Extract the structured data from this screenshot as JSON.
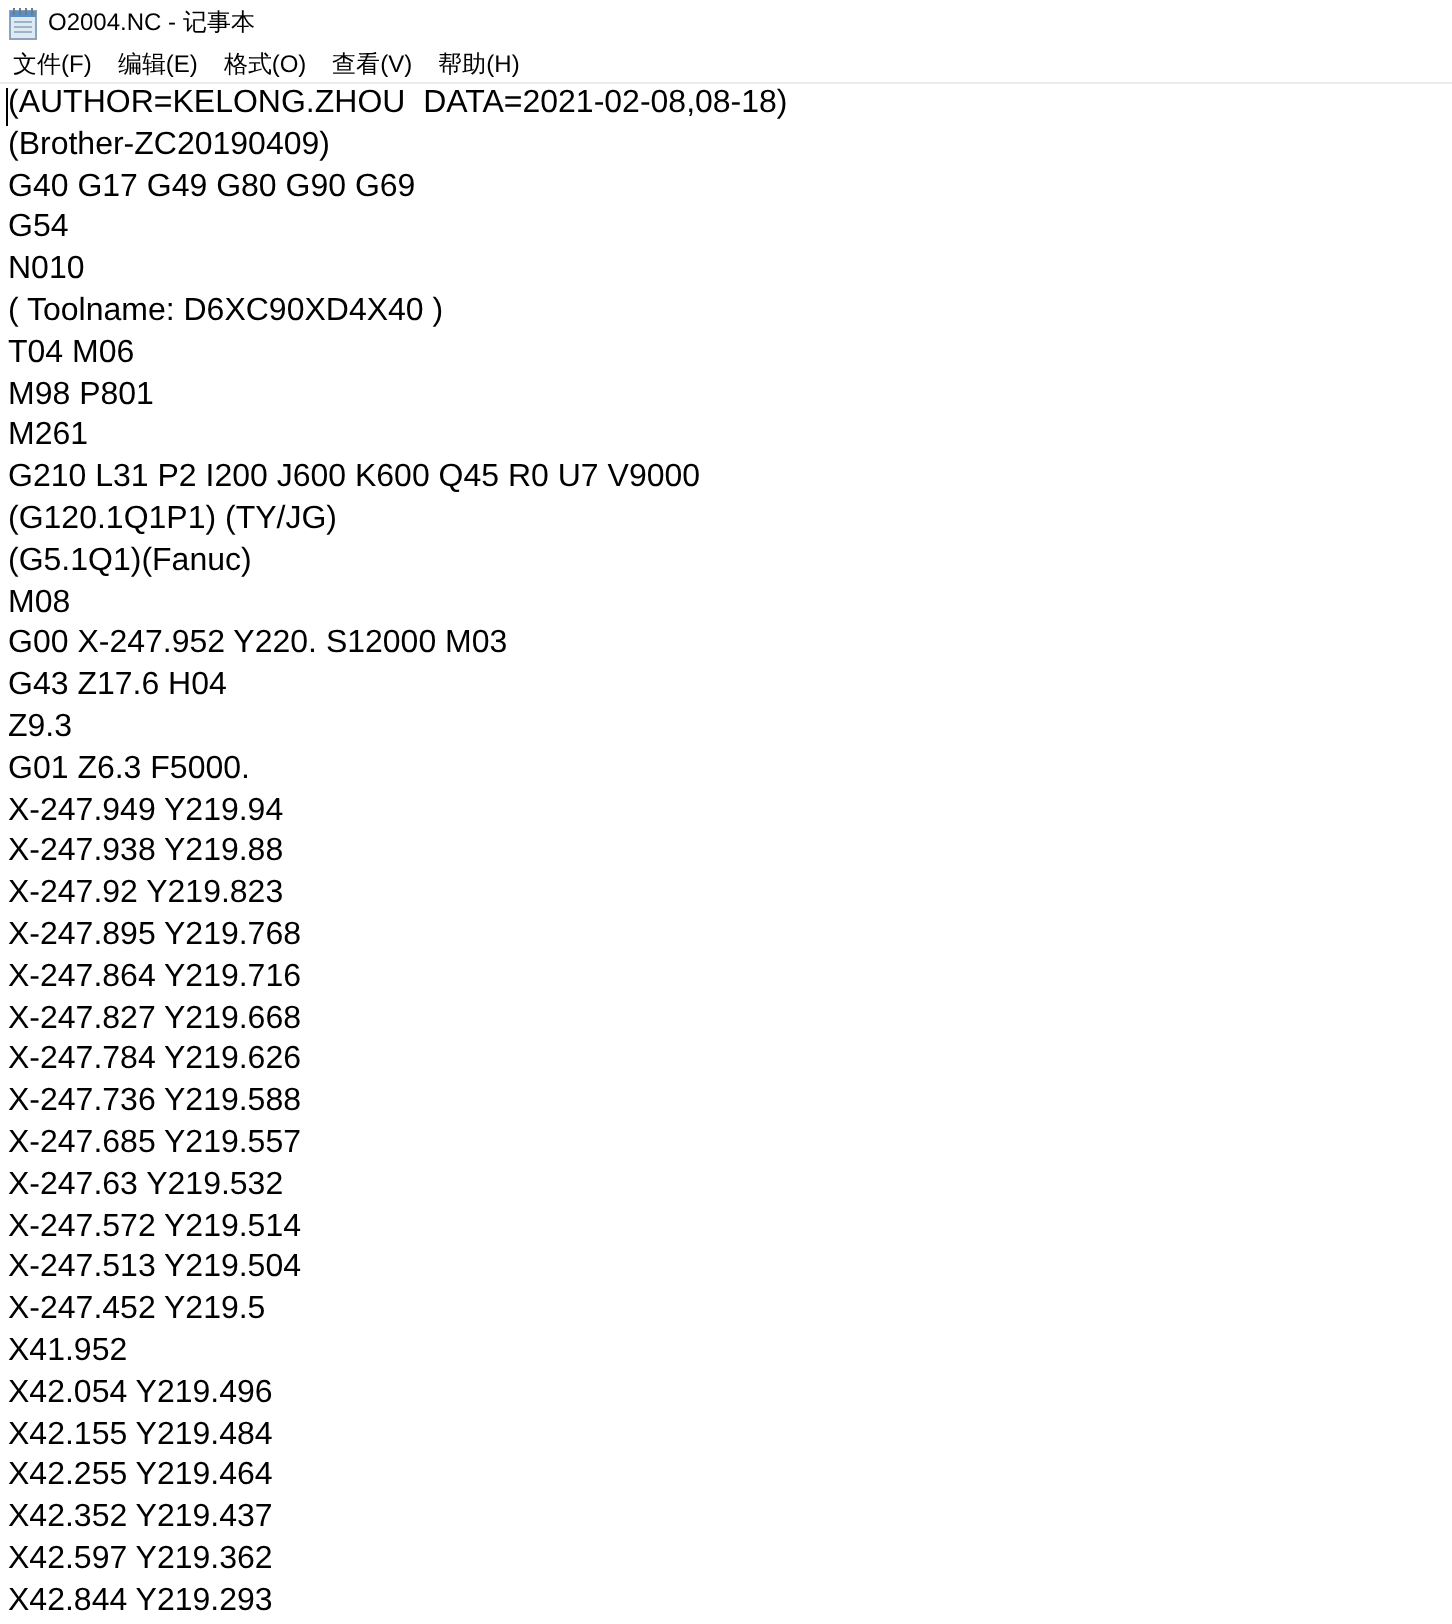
{
  "window": {
    "title": "O2004.NC - 记事本"
  },
  "menu": [
    "文件(F)",
    "编辑(E)",
    "格式(O)",
    "查看(V)",
    "帮助(H)"
  ],
  "editor": {
    "lines": [
      "(AUTHOR=KELONG.ZHOU  DATA=2021-02-08,08-18)",
      "(Brother-ZC20190409)",
      "G40 G17 G49 G80 G90 G69",
      "G54",
      "N010",
      "( Toolname: D6XC90XD4X40 )",
      "T04 M06",
      "M98 P801",
      "M261",
      "G210 L31 P2 I200 J600 K600 Q45 R0 U7 V9000",
      "(G120.1Q1P1) (TY/JG)",
      "(G5.1Q1)(Fanuc)",
      "M08",
      "G00 X-247.952 Y220. S12000 M03",
      "G43 Z17.6 H04",
      "Z9.3",
      "G01 Z6.3 F5000.",
      "X-247.949 Y219.94",
      "X-247.938 Y219.88",
      "X-247.92 Y219.823",
      "X-247.895 Y219.768",
      "X-247.864 Y219.716",
      "X-247.827 Y219.668",
      "X-247.784 Y219.626",
      "X-247.736 Y219.588",
      "X-247.685 Y219.557",
      "X-247.63 Y219.532",
      "X-247.572 Y219.514",
      "X-247.513 Y219.504",
      "X-247.452 Y219.5",
      "X41.952",
      "X42.054 Y219.496",
      "X42.155 Y219.484",
      "X42.255 Y219.464",
      "X42.352 Y219.437",
      "X42.597 Y219.362",
      "X42.844 Y219.293"
    ]
  }
}
